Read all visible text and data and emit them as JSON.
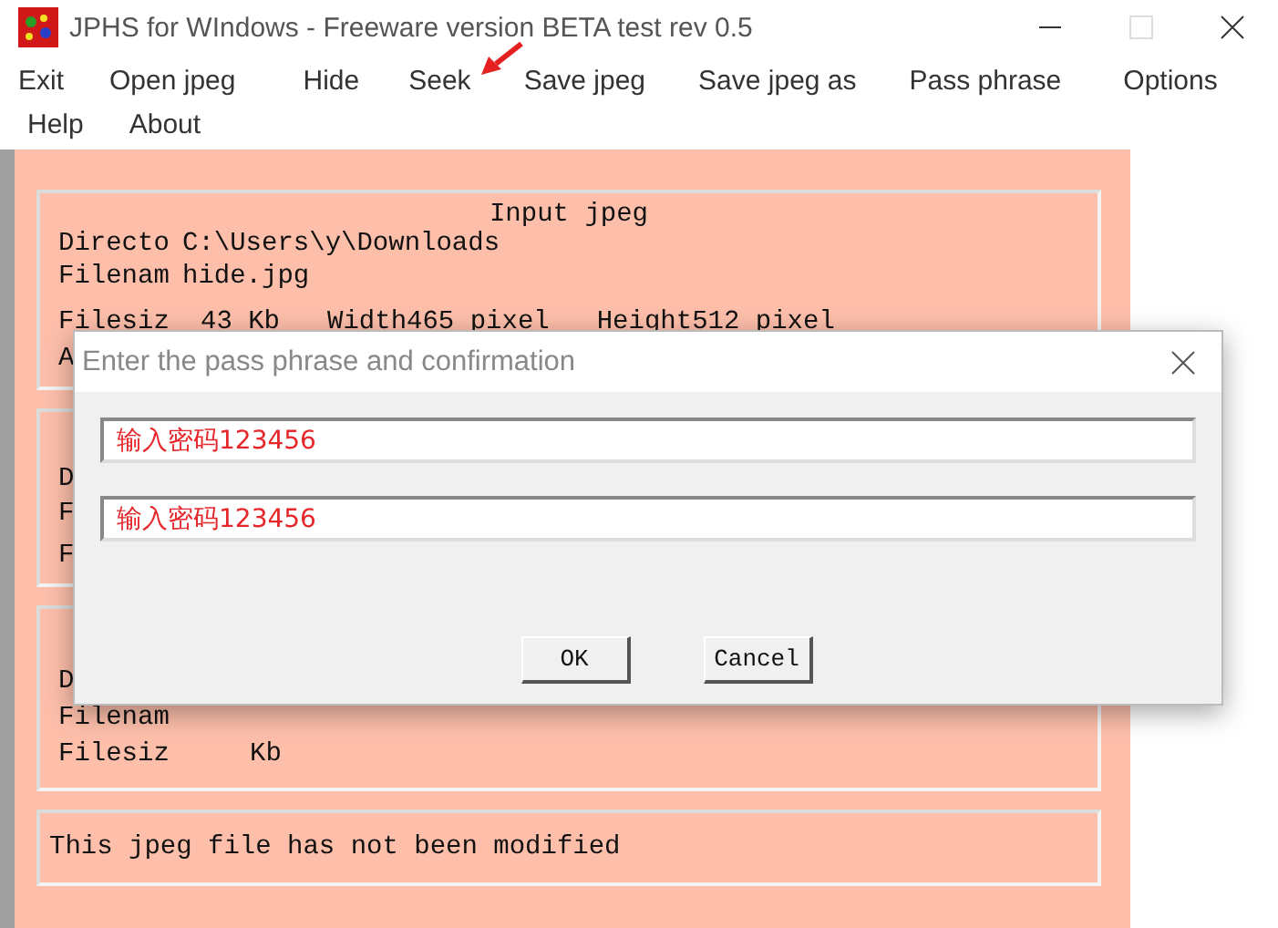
{
  "window": {
    "title": "JPHS for WIndows - Freeware version BETA test rev 0.5"
  },
  "menu": [
    [
      {
        "label": "Exit"
      },
      {
        "label": "Open jpeg"
      },
      {
        "label": "Hide"
      },
      {
        "label": "Seek"
      },
      {
        "label": "Save jpeg"
      },
      {
        "label": "Save jpeg as"
      },
      {
        "label": "Pass phrase"
      },
      {
        "label": "Options"
      }
    ],
    [
      {
        "label": "Help"
      },
      {
        "label": "About"
      }
    ]
  ],
  "input_group": {
    "heading": "Input jpeg",
    "directory_label": "Directo",
    "directory": "C:\\Users\\y\\Downloads",
    "filename_label": "Filenam",
    "filename": "hide.jpg",
    "filesize_label": "Filesiz",
    "filesize": "43 Kb",
    "width_label": "Width",
    "width": "465 pixel",
    "height_label": "Height",
    "height": "512 pixel",
    "row_4_label": "A"
  },
  "group_2": {
    "labels": [
      "D",
      "F",
      "F"
    ]
  },
  "group_3": {
    "labels": [
      "D",
      "Filenam",
      "Filesiz"
    ],
    "filesize": "Kb"
  },
  "status": "This jpeg file has not been modified",
  "dialog": {
    "title": "Enter the pass phrase and confirmation",
    "fields": [
      {
        "value": "输入密码123456"
      },
      {
        "value": "输入密码123456"
      }
    ],
    "buttons": [
      "OK",
      "Cancel"
    ]
  }
}
